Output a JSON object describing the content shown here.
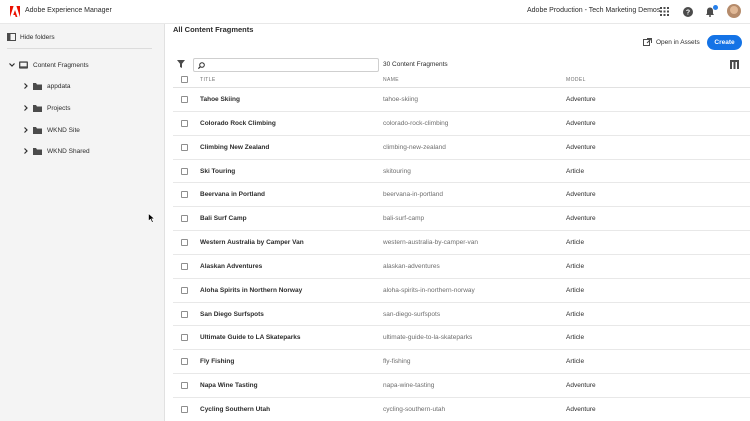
{
  "app": {
    "title": "Adobe Experience Manager",
    "org": "Adobe Production - Tech Marketing Demos",
    "brand_color": "#eb1000",
    "accent_color": "#1473e6"
  },
  "topbar": {
    "icons": [
      "apps-grid-icon",
      "help-icon",
      "bell-icon",
      "user-avatar"
    ]
  },
  "sidebar": {
    "hide_folders_label": "Hide folders",
    "root": {
      "label": "Content Fragments",
      "expanded": true
    },
    "items": [
      {
        "label": "appdata"
      },
      {
        "label": "Projects"
      },
      {
        "label": "WKND Site"
      },
      {
        "label": "WKND Shared"
      }
    ]
  },
  "main": {
    "page_title": "All Content Fragments",
    "open_in_assets_label": "Open in Assets",
    "create_label": "Create",
    "search": {
      "value": "",
      "placeholder": ""
    },
    "count_label": "30 Content Fragments",
    "columns": {
      "title": "TITLE",
      "name": "NAME",
      "model": "MODEL"
    },
    "rows": [
      {
        "title": "Tahoe Skiing",
        "name": "tahoe-skiing",
        "model": "Adventure"
      },
      {
        "title": "Colorado Rock Climbing",
        "name": "colorado-rock-climbing",
        "model": "Adventure"
      },
      {
        "title": "Climbing New Zealand",
        "name": "climbing-new-zealand",
        "model": "Adventure"
      },
      {
        "title": "Ski Touring",
        "name": "skitouring",
        "model": "Article"
      },
      {
        "title": "Beervana in Portland",
        "name": "beervana-in-portland",
        "model": "Adventure"
      },
      {
        "title": "Bali Surf Camp",
        "name": "bali-surf-camp",
        "model": "Adventure"
      },
      {
        "title": "Western Australia by Camper Van",
        "name": "western-australia-by-camper-van",
        "model": "Article"
      },
      {
        "title": "Alaskan Adventures",
        "name": "alaskan-adventures",
        "model": "Article"
      },
      {
        "title": "Aloha Spirits in Northern Norway",
        "name": "aloha-spirits-in-northern-norway",
        "model": "Article"
      },
      {
        "title": "San Diego Surfspots",
        "name": "san-diego-surfspots",
        "model": "Article"
      },
      {
        "title": "Ultimate Guide to LA Skateparks",
        "name": "ultimate-guide-to-la-skateparks",
        "model": "Article"
      },
      {
        "title": "Fly Fishing",
        "name": "fly-fishing",
        "model": "Article"
      },
      {
        "title": "Napa Wine Tasting",
        "name": "napa-wine-tasting",
        "model": "Adventure"
      },
      {
        "title": "Cycling Southern Utah",
        "name": "cycling-southern-utah",
        "model": "Adventure"
      }
    ]
  }
}
